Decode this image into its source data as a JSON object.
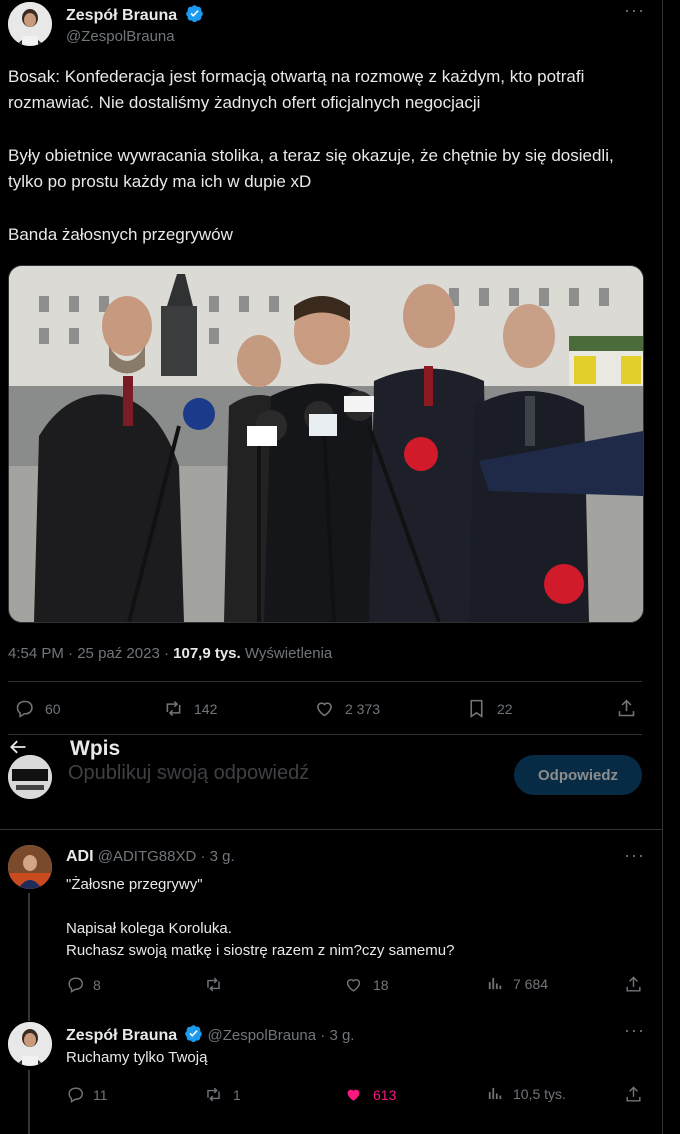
{
  "tweet": {
    "author_name": "Zespół Brauna",
    "author_handle": "@ZespolBrauna",
    "paragraphs": [
      "Bosak: Konfederacja jest formacją otwartą na rozmowę z każdym, kto potrafi rozmawiać. Nie dostaliśmy żadnych ofert oficjalnych negocjacji",
      "Były obietnice wywracania stolika, a teraz się okazuje, że chętnie by się dosiedli, tylko po prostu każdy ma ich w dupie xD",
      "Banda żałosnych przegrywów"
    ],
    "time": "4:54 PM",
    "date": "25 paź 2023",
    "views_count": "107,9 tys.",
    "views_label": "Wyświetlenia",
    "stats": {
      "replies": "60",
      "retweets": "142",
      "likes": "2 373",
      "bookmarks": "22"
    }
  },
  "sticky": {
    "title": "Wpis"
  },
  "composer": {
    "placeholder": "Opublikuj swoją odpowiedź",
    "button": "Odpowiedz"
  },
  "replies": [
    {
      "name": "ADI",
      "handle": "@ADITG88XD",
      "time": "· 3 g.",
      "lines": [
        "\"Żałosne przegrywy\"",
        "Napisał kolega Koroluka.",
        "Ruchasz swoją matkę i siostrę razem z nim?czy samemu?"
      ],
      "stats": {
        "replies": "8",
        "retweets": "",
        "likes": "18",
        "views": "7 684"
      }
    },
    {
      "name": "Zespół Brauna",
      "handle": "@ZespolBrauna",
      "time": "· 3 g.",
      "lines": [
        "Ruchamy tylko Twoją"
      ],
      "stats": {
        "replies": "11",
        "retweets": "1",
        "likes": "613",
        "views": "10,5 tys."
      }
    }
  ],
  "colors": {
    "background": "#000000",
    "text": "#e7e9ea",
    "muted": "#71767b",
    "verified": "#1d9bf0",
    "like": "#f91880"
  }
}
